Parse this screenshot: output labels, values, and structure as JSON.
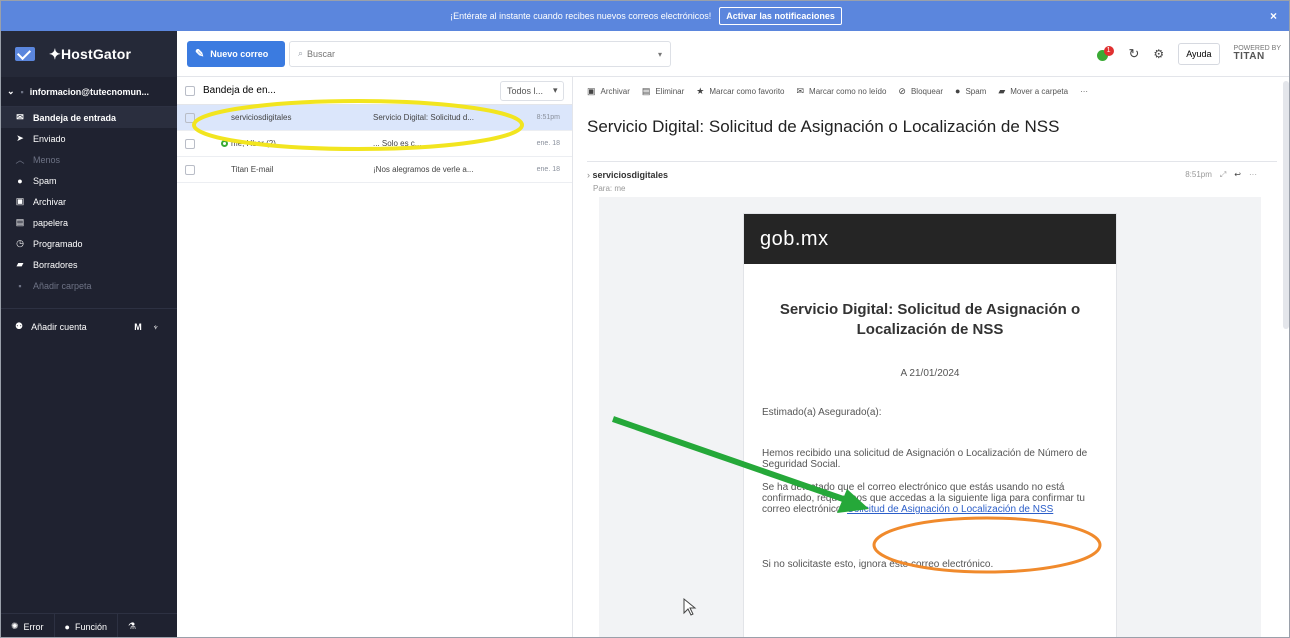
{
  "banner": {
    "text": "¡Entérate al instante cuando recibes nuevos correos electrónicos!",
    "button_label": "Activar las notificaciones",
    "close_glyph": "×"
  },
  "sidebar": {
    "brand": "HostGator",
    "account": "informacion@tutecnomun...",
    "items": [
      {
        "label": "Bandeja de entrada",
        "icon": "inbox-icon",
        "glyph": "✉"
      },
      {
        "label": "Enviado",
        "icon": "send-icon",
        "glyph": "➤"
      },
      {
        "label": "Menos",
        "icon": "chevron-up-icon",
        "glyph": "︿"
      },
      {
        "label": "Spam",
        "icon": "spam-icon",
        "glyph": "●"
      },
      {
        "label": "Archivar",
        "icon": "archive-icon",
        "glyph": "▣"
      },
      {
        "label": "papelera",
        "icon": "trash-icon",
        "glyph": "▤"
      },
      {
        "label": "Programado",
        "icon": "scheduled-icon",
        "glyph": "◷"
      },
      {
        "label": "Borradores",
        "icon": "drafts-icon",
        "glyph": "▰"
      },
      {
        "label": "Añadir carpeta",
        "icon": "add-folder-icon",
        "glyph": "▪"
      }
    ],
    "add_account": "Añadir cuenta",
    "footer": {
      "error": "Error",
      "function": "Función"
    }
  },
  "topbar": {
    "compose_label": "Nuevo correo",
    "search_placeholder": "Buscar",
    "help": "Ayuda",
    "powered_by": "POWERED BY",
    "titan": "TITAN",
    "badge": "1"
  },
  "list": {
    "folder": "Bandeja de en...",
    "filter": "Todos l...",
    "rows": [
      {
        "sender": "serviciosdigitales",
        "subject": "Servicio Digital: Solicitud d...",
        "time": "8:51pm"
      },
      {
        "sender": "me, Hber (2)",
        "subject": "... Solo es c...",
        "time": "ene. 18"
      },
      {
        "sender": "Titan E-mail",
        "subject": "¡Nos alegramos de verle a...",
        "time": "ene. 18"
      }
    ]
  },
  "reader": {
    "actions": [
      "Archivar",
      "Eliminar",
      "Marcar como favorito",
      "Marcar como no leído",
      "Bloquear",
      "Spam",
      "Mover a carpeta",
      "···"
    ],
    "subject": "Servicio Digital: Solicitud de Asignación o Localización de NSS",
    "from": "serviciosdigitales",
    "to": "Para: me",
    "time": "8:51pm",
    "email": {
      "header": "gob.mx",
      "title": "Servicio Digital: Solicitud de Asignación o Localización de NSS",
      "date": "A 21/01/2024",
      "greeting": "Estimado(a) Asegurado(a):",
      "p1": "Hemos recibido una solicitud de Asignación o Localización de Número de Seguridad Social.",
      "p2": "Se ha detectado que el correo electrónico que estás usando no está confirmado, requerimos que accedas a la siguiente liga para confirmar tu correo electrónico:",
      "link": "Solicitud de Asignación o Localización de NSS",
      "p3": "Si no solicitaste esto, ignora este correo electrónico."
    }
  }
}
